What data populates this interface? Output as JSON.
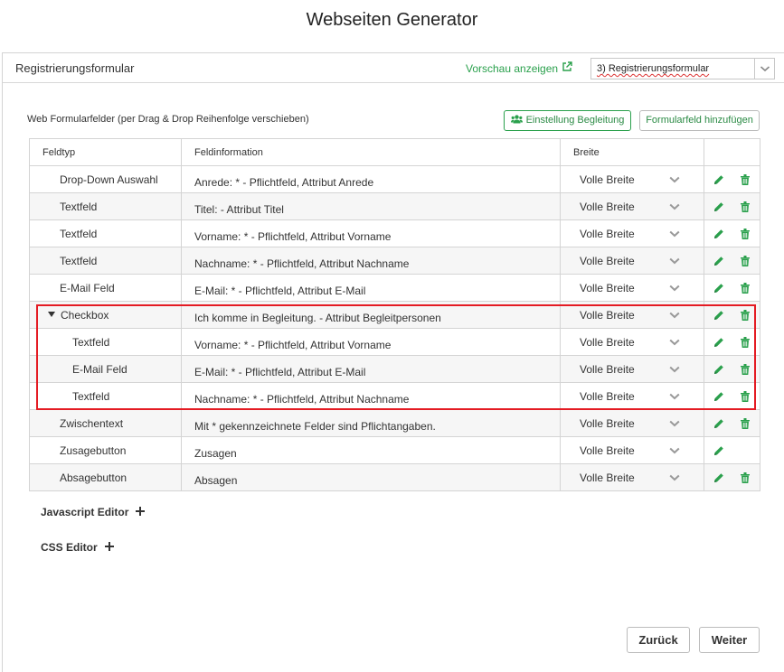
{
  "app": {
    "title": "Webseiten Generator"
  },
  "panel": {
    "title": "Registrierungsformular",
    "preview_label": "Vorschau anzeigen",
    "form_select_value": "3) Registrierungsformular"
  },
  "section": {
    "label": "Web Formularfelder (per Drag & Drop Reihenfolge verschieben)"
  },
  "buttons": {
    "begleitung": "Einstellung Begleitung",
    "add_field": "Formularfeld hinzufügen",
    "back": "Zurück",
    "next": "Weiter"
  },
  "table": {
    "headers": [
      "Feldtyp",
      "Feldinformation",
      "Breite",
      ""
    ],
    "rows": [
      {
        "type": "Drop-Down Auswahl",
        "info": "Anrede: * - Pflichtfeld, Attribut Anrede",
        "width": "Volle Breite"
      },
      {
        "type": "Textfeld",
        "info": "Titel: - Attribut Titel",
        "width": "Volle Breite"
      },
      {
        "type": "Textfeld",
        "info": "Vorname: * - Pflichtfeld, Attribut Vorname",
        "width": "Volle Breite"
      },
      {
        "type": "Textfeld",
        "info": "Nachname: * - Pflichtfeld, Attribut Nachname",
        "width": "Volle Breite"
      },
      {
        "type": "E-Mail Feld",
        "info": "E-Mail: * - Pflichtfeld, Attribut E-Mail",
        "width": "Volle Breite"
      },
      {
        "type": "Checkbox",
        "info": "Ich komme in Begleitung. - Attribut Begleitpersonen",
        "width": "Volle Breite"
      },
      {
        "type": "Textfeld",
        "info": "Vorname: * - Pflichtfeld, Attribut Vorname",
        "width": "Volle Breite"
      },
      {
        "type": "E-Mail Feld",
        "info": "E-Mail: * - Pflichtfeld, Attribut E-Mail",
        "width": "Volle Breite"
      },
      {
        "type": "Textfeld",
        "info": "Nachname: * - Pflichtfeld, Attribut Nachname",
        "width": "Volle Breite"
      },
      {
        "type": "Zwischentext",
        "info": "Mit * gekennzeichnete Felder sind Pflichtangaben.",
        "width": "Volle Breite"
      },
      {
        "type": "Zusagebutton",
        "info": "Zusagen",
        "width": "Volle Breite"
      },
      {
        "type": "Absagebutton",
        "info": "Absagen",
        "width": "Volle Breite"
      }
    ]
  },
  "editors": {
    "js": "Javascript Editor",
    "css": "CSS Editor"
  },
  "colors": {
    "accent_green": "#2aa04c",
    "highlight_red": "#e41b23"
  },
  "icons": [
    "external-link-icon",
    "chevron-down-icon",
    "users-icon",
    "pencil-icon",
    "trash-icon",
    "plus-icon",
    "caret-down-icon"
  ]
}
